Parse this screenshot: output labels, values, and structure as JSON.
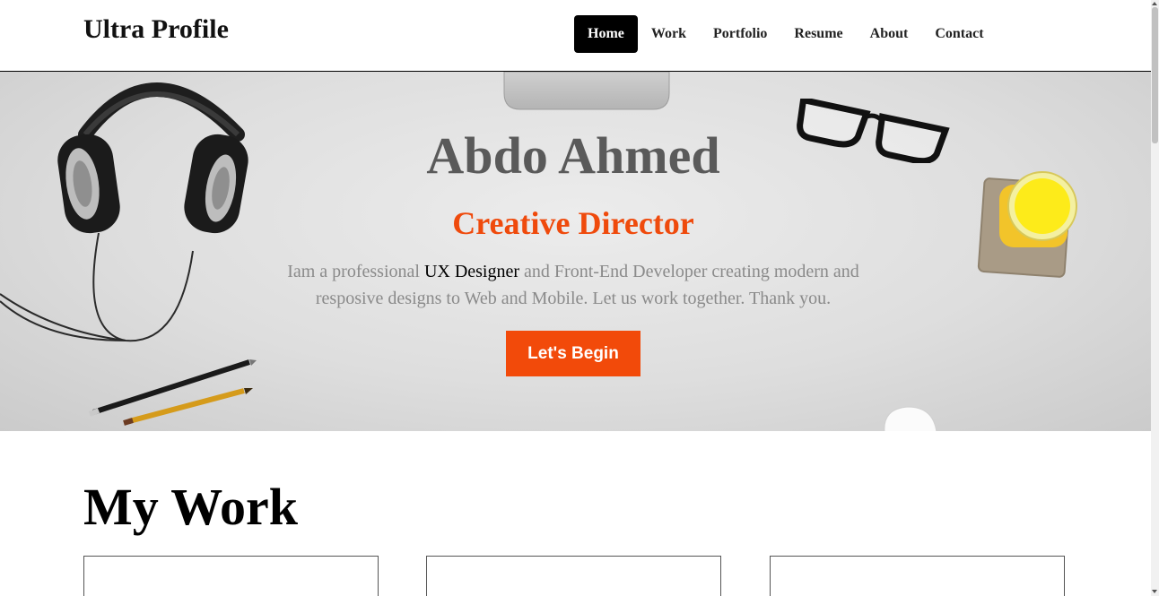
{
  "header": {
    "logo": "Ultra Profile",
    "nav": [
      {
        "label": "Home",
        "active": true
      },
      {
        "label": "Work"
      },
      {
        "label": "Portfolio"
      },
      {
        "label": "Resume"
      },
      {
        "label": "About"
      },
      {
        "label": "Contact"
      }
    ]
  },
  "hero": {
    "name": "Abdo Ahmed",
    "role": "Creative Director",
    "intro_before": "Iam a professional ",
    "intro_highlight": "UX Designer",
    "intro_after": " and Front-End Developer creating modern and resposive designs to Web and Mobile. Let us work together. Thank you.",
    "cta_label": "Let's Begin"
  },
  "work": {
    "heading_light": "My ",
    "heading_bold": "Work"
  },
  "colors": {
    "accent": "#f24a0a",
    "nav_active_bg": "#000000",
    "hero_title": "#5a5a5a",
    "hero_text": "#8a8a8a"
  },
  "decor_icons": [
    "headphones-icon",
    "pencils-icon",
    "glasses-icon",
    "orange-juice-icon",
    "monitor-stand-icon",
    "mouse-icon"
  ]
}
